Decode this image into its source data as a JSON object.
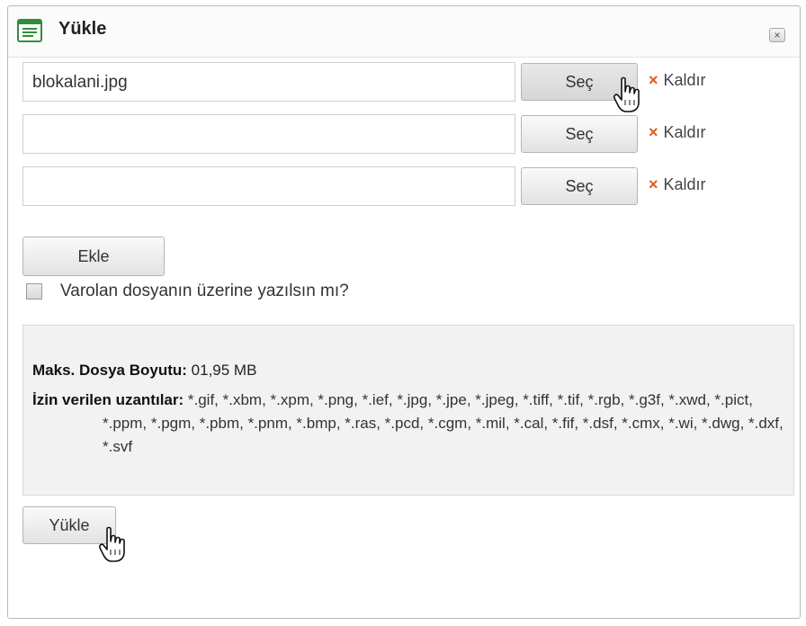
{
  "dialog": {
    "title": "Yükle",
    "title_icon": "form-icon",
    "close_icon": "close-icon",
    "close_glyph": "×"
  },
  "files": [
    {
      "value": "blokalani.jpg",
      "select_label": "Seç",
      "remove_label": "Kaldır",
      "remove_glyph": "×"
    },
    {
      "value": "",
      "select_label": "Seç",
      "remove_label": "Kaldır",
      "remove_glyph": "×"
    },
    {
      "value": "",
      "select_label": "Seç",
      "remove_label": "Kaldır",
      "remove_glyph": "×"
    }
  ],
  "add_label": "Ekle",
  "overwrite": {
    "label": "Varolan dosyanın üzerine yazılsın mı?",
    "checked": false
  },
  "info": {
    "max_size_label": "Maks. Dosya Boyutu:",
    "max_size_value": "01,95 MB",
    "extensions_label": "İzin verilen uzantılar:",
    "extensions_value": "*.gif, *.xbm, *.xpm, *.png, *.ief, *.jpg, *.jpe, *.jpeg, *.tiff, *.tif, *.rgb, *.g3f, *.xwd, *.pict, *.ppm, *.pgm, *.pbm, *.pnm, *.bmp, *.ras, *.pcd, *.cgm, *.mil, *.cal, *.fif, *.dsf, *.cmx, *.wi, *.dwg, *.dxf, *.svf"
  },
  "upload_label": "Yükle",
  "colors": {
    "remove_x": "#e05a1a",
    "title_icon": "#2f8f3a"
  }
}
